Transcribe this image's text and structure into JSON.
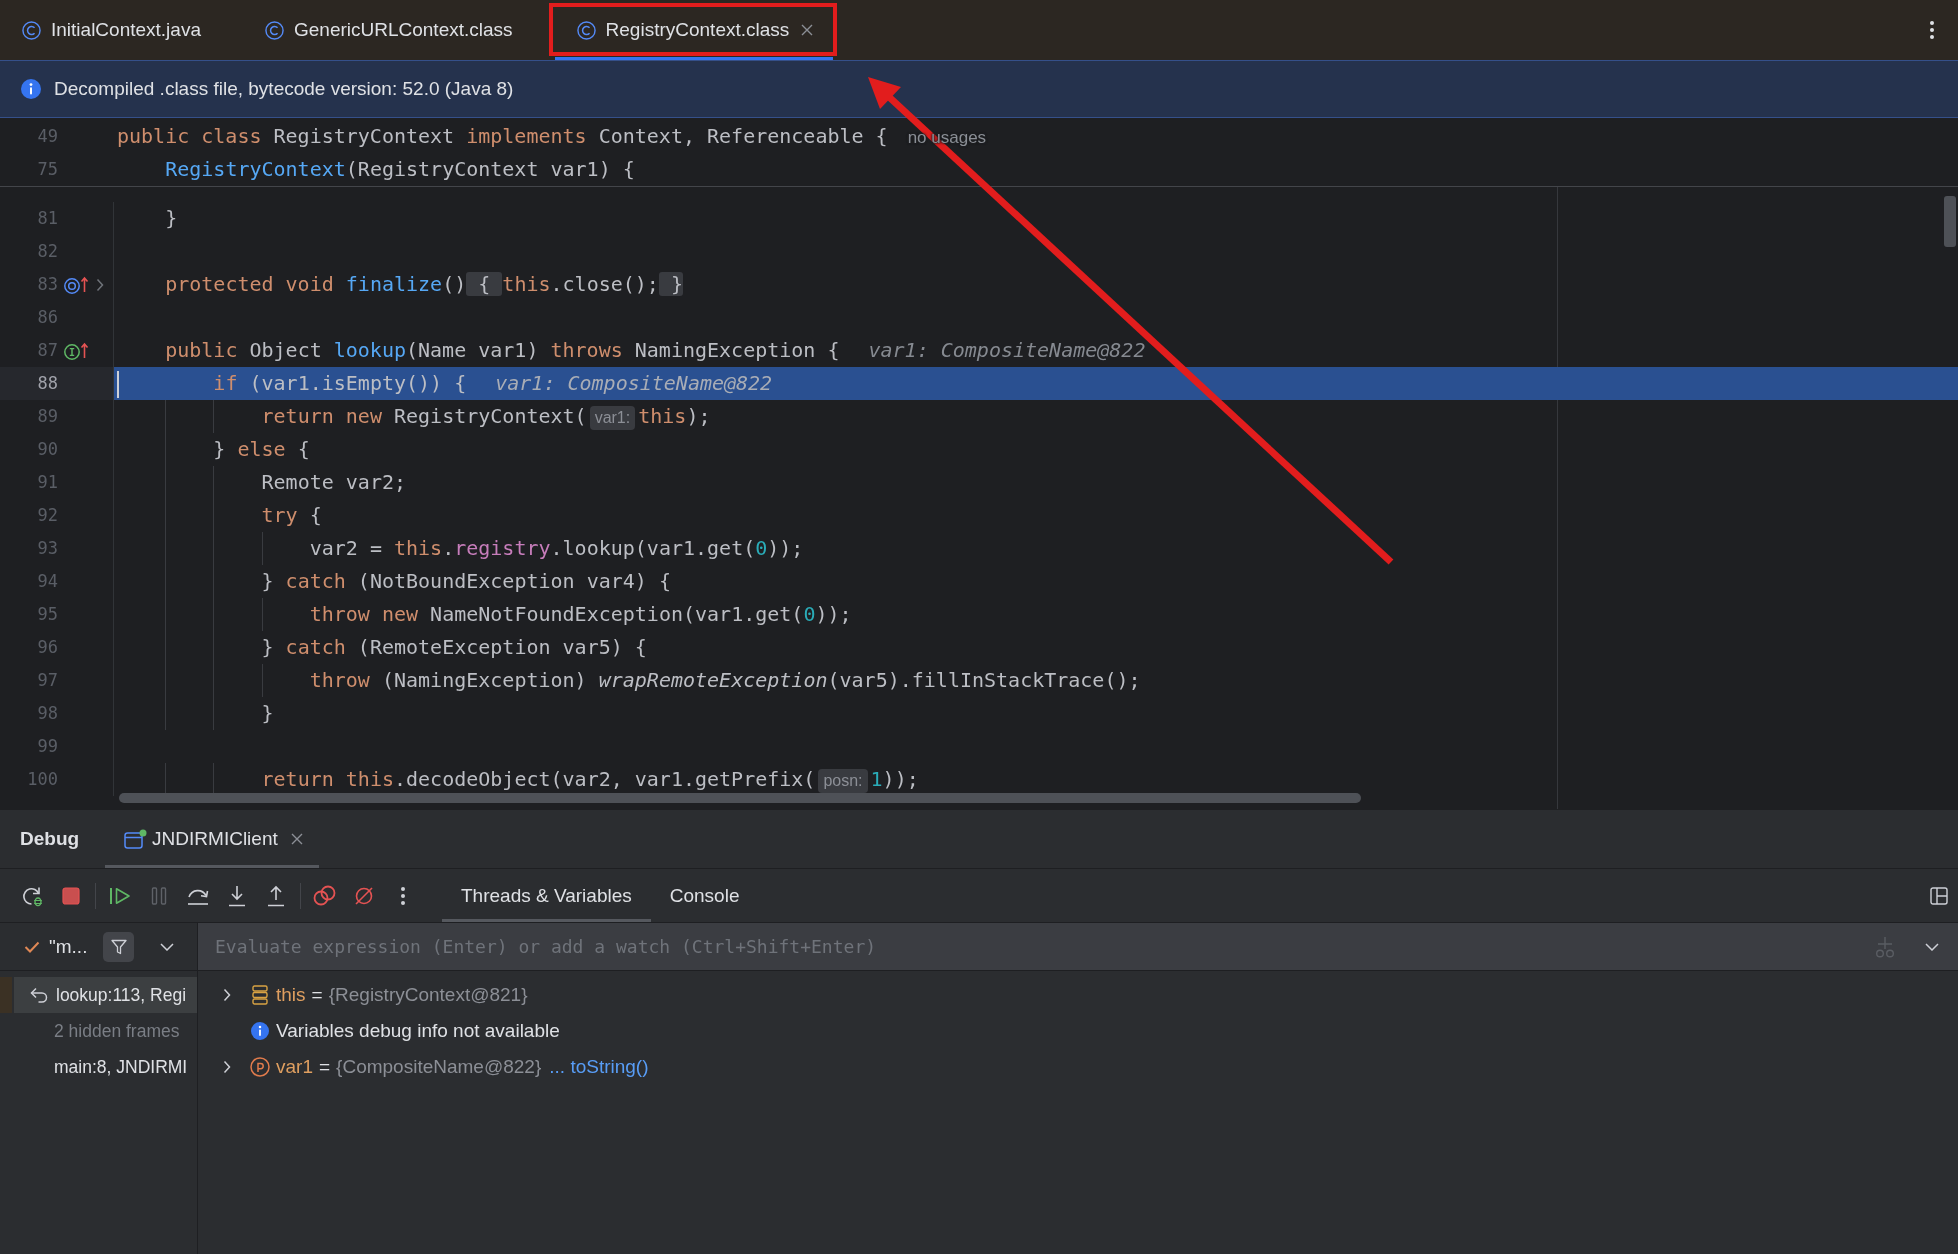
{
  "tabs": [
    {
      "label": "InitialContext.java",
      "selected": false,
      "closable": false,
      "outlined": false
    },
    {
      "label": "GenericURLContext.class",
      "selected": false,
      "closable": false,
      "outlined": false
    },
    {
      "label": "RegistryContext.class",
      "selected": true,
      "closable": true,
      "outlined": true
    }
  ],
  "banner": {
    "text": "Decompiled .class file, bytecode version: 52.0 (Java 8)"
  },
  "editor": {
    "sticky_lines": [
      {
        "number": "49",
        "tokens": [
          {
            "kind": "keyword",
            "text": "public class"
          },
          {
            "kind": "plain",
            "text": " RegistryContext "
          },
          {
            "kind": "keyword",
            "text": "implements"
          },
          {
            "kind": "plain",
            "text": " Context, Referenceable {"
          },
          {
            "kind": "usages",
            "text": "no usages"
          }
        ]
      },
      {
        "number": "75",
        "tokens": [
          {
            "kind": "method",
            "text": "    RegistryContext"
          },
          {
            "kind": "plain",
            "text": "(RegistryContext var1) {"
          }
        ]
      }
    ],
    "lines": [
      {
        "number": "81",
        "current": false,
        "tokens": [
          {
            "kind": "plain",
            "text": "    }"
          }
        ]
      },
      {
        "number": "82",
        "current": false
      },
      {
        "number": "83",
        "current": false,
        "marker": {
          "kind": "overrides"
        },
        "folded": true,
        "tokens": [
          {
            "kind": "keyword",
            "text": "    protected void "
          },
          {
            "kind": "method",
            "text": "finalize"
          },
          {
            "kind": "plain",
            "text": "()"
          },
          {
            "kind": "fold",
            "text": " { "
          },
          {
            "kind": "keyword",
            "text": "this"
          },
          {
            "kind": "plain",
            "text": ".close();"
          },
          {
            "kind": "fold",
            "text": " }"
          }
        ]
      },
      {
        "number": "86",
        "current": false
      },
      {
        "number": "87",
        "current": false,
        "marker": {
          "kind": "implements"
        },
        "tokens": [
          {
            "kind": "keyword",
            "text": "    public"
          },
          {
            "kind": "plain",
            "text": " Object "
          },
          {
            "kind": "method",
            "text": "lookup"
          },
          {
            "kind": "plain",
            "text": "(Name var1) "
          },
          {
            "kind": "keyword",
            "text": "throws"
          },
          {
            "kind": "plain",
            "text": " NamingException {"
          },
          {
            "kind": "inline_value",
            "text": "var1: CompositeName@822"
          }
        ]
      },
      {
        "number": "88",
        "current": true,
        "tokens": [
          {
            "kind": "keyword",
            "text": "        if"
          },
          {
            "kind": "plain",
            "text": " (var1.isEmpty()) {"
          },
          {
            "kind": "inline_value",
            "text": "var1: CompositeName@822"
          }
        ]
      },
      {
        "number": "89",
        "current": false,
        "tokens": [
          {
            "kind": "keyword",
            "text": "            return new"
          },
          {
            "kind": "plain",
            "text": " RegistryContext("
          },
          {
            "kind": "param_hint",
            "text": "var1:"
          },
          {
            "kind": "keyword",
            "text": "this"
          },
          {
            "kind": "plain",
            "text": ");"
          }
        ]
      },
      {
        "number": "90",
        "current": false,
        "tokens": [
          {
            "kind": "plain",
            "text": "        } "
          },
          {
            "kind": "keyword",
            "text": "else"
          },
          {
            "kind": "plain",
            "text": " {"
          }
        ]
      },
      {
        "number": "91",
        "current": false,
        "tokens": [
          {
            "kind": "plain",
            "text": "            Remote var2;"
          }
        ]
      },
      {
        "number": "92",
        "current": false,
        "tokens": [
          {
            "kind": "keyword",
            "text": "            try"
          },
          {
            "kind": "plain",
            "text": " {"
          }
        ]
      },
      {
        "number": "93",
        "current": false,
        "tokens": [
          {
            "kind": "plain",
            "text": "                var2 = "
          },
          {
            "kind": "keyword",
            "text": "this"
          },
          {
            "kind": "plain",
            "text": "."
          },
          {
            "kind": "field",
            "text": "registry"
          },
          {
            "kind": "plain",
            "text": ".lookup(var1.get("
          },
          {
            "kind": "number",
            "text": "0"
          },
          {
            "kind": "plain",
            "text": "));"
          }
        ]
      },
      {
        "number": "94",
        "current": false,
        "tokens": [
          {
            "kind": "plain",
            "text": "            } "
          },
          {
            "kind": "keyword",
            "text": "catch"
          },
          {
            "kind": "plain",
            "text": " (NotBoundException var4) {"
          }
        ]
      },
      {
        "number": "95",
        "current": false,
        "tokens": [
          {
            "kind": "keyword",
            "text": "                throw new"
          },
          {
            "kind": "plain",
            "text": " NameNotFoundException(var1.get("
          },
          {
            "kind": "number",
            "text": "0"
          },
          {
            "kind": "plain",
            "text": "));"
          }
        ]
      },
      {
        "number": "96",
        "current": false,
        "tokens": [
          {
            "kind": "plain",
            "text": "            } "
          },
          {
            "kind": "keyword",
            "text": "catch"
          },
          {
            "kind": "plain",
            "text": " (RemoteException var5) {"
          }
        ]
      },
      {
        "number": "97",
        "current": false,
        "tokens": [
          {
            "kind": "keyword",
            "text": "                throw"
          },
          {
            "kind": "plain",
            "text": " (NamingException) "
          },
          {
            "kind": "italic",
            "text": "wrapRemoteException"
          },
          {
            "kind": "plain",
            "text": "(var5).fillInStackTrace();"
          }
        ]
      },
      {
        "number": "98",
        "current": false,
        "tokens": [
          {
            "kind": "plain",
            "text": "            }"
          }
        ]
      },
      {
        "number": "99",
        "current": false
      },
      {
        "number": "100",
        "current": false,
        "tokens": [
          {
            "kind": "keyword",
            "text": "            return this"
          },
          {
            "kind": "plain",
            "text": ".decodeObject(var2, var1.getPrefix("
          },
          {
            "kind": "param_hint",
            "text": "posn:"
          },
          {
            "kind": "number",
            "text": "1"
          },
          {
            "kind": "plain",
            "text": "));"
          }
        ]
      }
    ]
  },
  "debug": {
    "title": "Debug",
    "sessions": [
      {
        "label": "JNDIRMIClient",
        "selected": true,
        "closable": true
      }
    ],
    "toolbar": [
      {
        "kind": "restart",
        "disabled": false
      },
      {
        "kind": "stop",
        "disabled": false
      },
      {
        "kind": "separator"
      },
      {
        "kind": "resume",
        "disabled": false
      },
      {
        "kind": "pause",
        "disabled": true
      },
      {
        "kind": "step_over",
        "disabled": false
      },
      {
        "kind": "step_into",
        "disabled": false
      },
      {
        "kind": "step_out",
        "disabled": false
      },
      {
        "kind": "separator"
      },
      {
        "kind": "breakpoints",
        "disabled": false
      },
      {
        "kind": "mute",
        "disabled": false
      },
      {
        "kind": "more",
        "disabled": false
      }
    ],
    "views": [
      {
        "label": "Threads & Variables",
        "selected": true
      },
      {
        "label": "Console",
        "selected": false
      }
    ],
    "thread": {
      "label": "\"m..."
    },
    "evaluate": {
      "placeholder": "Evaluate expression (Enter) or add a watch (Ctrl+Shift+Enter)"
    },
    "frames": [
      {
        "kind": "frame",
        "text": "lookup:113, Regi",
        "selected": true
      },
      {
        "kind": "hidden",
        "text": "2 hidden frames",
        "selected": false
      },
      {
        "kind": "frame",
        "text": "main:8, JNDIRMI",
        "selected": false
      }
    ],
    "variables": [
      {
        "kind": "field",
        "name": "this",
        "operator": "=",
        "value": "{RegistryContext@821}",
        "expanded": false
      },
      {
        "kind": "info",
        "text": "Variables debug info not available"
      },
      {
        "kind": "parameter",
        "name": "var1",
        "operator": "=",
        "value": "{CompositeName@822}",
        "link": "... toString()",
        "expanded": false
      }
    ]
  },
  "annotations": [
    {
      "kind": "arrow"
    }
  ]
}
